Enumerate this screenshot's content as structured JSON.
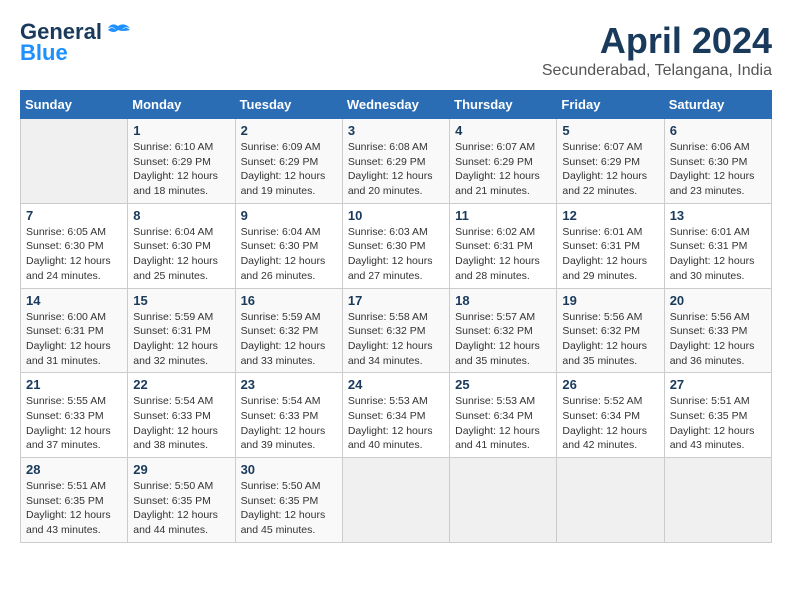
{
  "header": {
    "logo_line1": "General",
    "logo_line2": "Blue",
    "month": "April 2024",
    "location": "Secunderabad, Telangana, India"
  },
  "calendar": {
    "days_of_week": [
      "Sunday",
      "Monday",
      "Tuesday",
      "Wednesday",
      "Thursday",
      "Friday",
      "Saturday"
    ],
    "weeks": [
      [
        {
          "day": "",
          "info": ""
        },
        {
          "day": "1",
          "info": "Sunrise: 6:10 AM\nSunset: 6:29 PM\nDaylight: 12 hours\nand 18 minutes."
        },
        {
          "day": "2",
          "info": "Sunrise: 6:09 AM\nSunset: 6:29 PM\nDaylight: 12 hours\nand 19 minutes."
        },
        {
          "day": "3",
          "info": "Sunrise: 6:08 AM\nSunset: 6:29 PM\nDaylight: 12 hours\nand 20 minutes."
        },
        {
          "day": "4",
          "info": "Sunrise: 6:07 AM\nSunset: 6:29 PM\nDaylight: 12 hours\nand 21 minutes."
        },
        {
          "day": "5",
          "info": "Sunrise: 6:07 AM\nSunset: 6:29 PM\nDaylight: 12 hours\nand 22 minutes."
        },
        {
          "day": "6",
          "info": "Sunrise: 6:06 AM\nSunset: 6:30 PM\nDaylight: 12 hours\nand 23 minutes."
        }
      ],
      [
        {
          "day": "7",
          "info": "Sunrise: 6:05 AM\nSunset: 6:30 PM\nDaylight: 12 hours\nand 24 minutes."
        },
        {
          "day": "8",
          "info": "Sunrise: 6:04 AM\nSunset: 6:30 PM\nDaylight: 12 hours\nand 25 minutes."
        },
        {
          "day": "9",
          "info": "Sunrise: 6:04 AM\nSunset: 6:30 PM\nDaylight: 12 hours\nand 26 minutes."
        },
        {
          "day": "10",
          "info": "Sunrise: 6:03 AM\nSunset: 6:30 PM\nDaylight: 12 hours\nand 27 minutes."
        },
        {
          "day": "11",
          "info": "Sunrise: 6:02 AM\nSunset: 6:31 PM\nDaylight: 12 hours\nand 28 minutes."
        },
        {
          "day": "12",
          "info": "Sunrise: 6:01 AM\nSunset: 6:31 PM\nDaylight: 12 hours\nand 29 minutes."
        },
        {
          "day": "13",
          "info": "Sunrise: 6:01 AM\nSunset: 6:31 PM\nDaylight: 12 hours\nand 30 minutes."
        }
      ],
      [
        {
          "day": "14",
          "info": "Sunrise: 6:00 AM\nSunset: 6:31 PM\nDaylight: 12 hours\nand 31 minutes."
        },
        {
          "day": "15",
          "info": "Sunrise: 5:59 AM\nSunset: 6:31 PM\nDaylight: 12 hours\nand 32 minutes."
        },
        {
          "day": "16",
          "info": "Sunrise: 5:59 AM\nSunset: 6:32 PM\nDaylight: 12 hours\nand 33 minutes."
        },
        {
          "day": "17",
          "info": "Sunrise: 5:58 AM\nSunset: 6:32 PM\nDaylight: 12 hours\nand 34 minutes."
        },
        {
          "day": "18",
          "info": "Sunrise: 5:57 AM\nSunset: 6:32 PM\nDaylight: 12 hours\nand 35 minutes."
        },
        {
          "day": "19",
          "info": "Sunrise: 5:56 AM\nSunset: 6:32 PM\nDaylight: 12 hours\nand 35 minutes."
        },
        {
          "day": "20",
          "info": "Sunrise: 5:56 AM\nSunset: 6:33 PM\nDaylight: 12 hours\nand 36 minutes."
        }
      ],
      [
        {
          "day": "21",
          "info": "Sunrise: 5:55 AM\nSunset: 6:33 PM\nDaylight: 12 hours\nand 37 minutes."
        },
        {
          "day": "22",
          "info": "Sunrise: 5:54 AM\nSunset: 6:33 PM\nDaylight: 12 hours\nand 38 minutes."
        },
        {
          "day": "23",
          "info": "Sunrise: 5:54 AM\nSunset: 6:33 PM\nDaylight: 12 hours\nand 39 minutes."
        },
        {
          "day": "24",
          "info": "Sunrise: 5:53 AM\nSunset: 6:34 PM\nDaylight: 12 hours\nand 40 minutes."
        },
        {
          "day": "25",
          "info": "Sunrise: 5:53 AM\nSunset: 6:34 PM\nDaylight: 12 hours\nand 41 minutes."
        },
        {
          "day": "26",
          "info": "Sunrise: 5:52 AM\nSunset: 6:34 PM\nDaylight: 12 hours\nand 42 minutes."
        },
        {
          "day": "27",
          "info": "Sunrise: 5:51 AM\nSunset: 6:35 PM\nDaylight: 12 hours\nand 43 minutes."
        }
      ],
      [
        {
          "day": "28",
          "info": "Sunrise: 5:51 AM\nSunset: 6:35 PM\nDaylight: 12 hours\nand 43 minutes."
        },
        {
          "day": "29",
          "info": "Sunrise: 5:50 AM\nSunset: 6:35 PM\nDaylight: 12 hours\nand 44 minutes."
        },
        {
          "day": "30",
          "info": "Sunrise: 5:50 AM\nSunset: 6:35 PM\nDaylight: 12 hours\nand 45 minutes."
        },
        {
          "day": "",
          "info": ""
        },
        {
          "day": "",
          "info": ""
        },
        {
          "day": "",
          "info": ""
        },
        {
          "day": "",
          "info": ""
        }
      ]
    ]
  }
}
